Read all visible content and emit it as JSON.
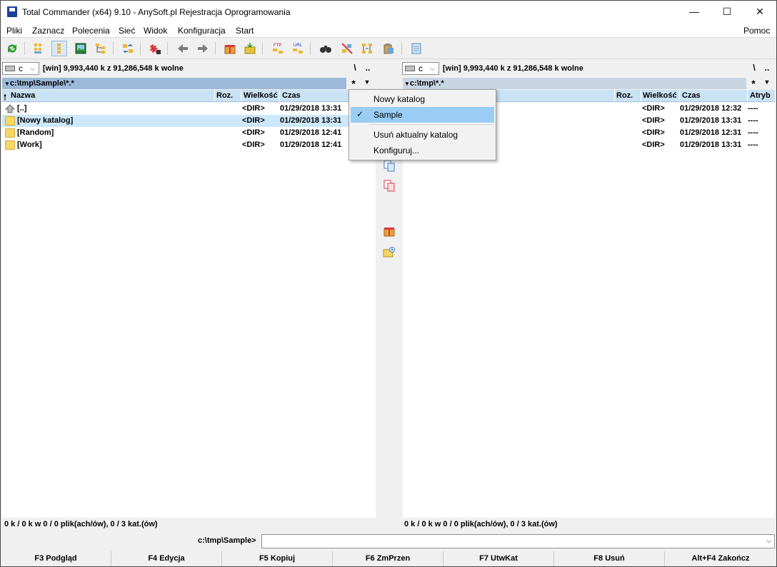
{
  "window": {
    "title": "Total Commander (x64) 9.10 - AnySoft.pl  Rejestracja Oprogramowania",
    "controls": [
      "—",
      "☐",
      "✕"
    ]
  },
  "menu": {
    "items": [
      "Pliki",
      "Zaznacz",
      "Polecenia",
      "Sieć",
      "Widok",
      "Konfiguracja",
      "Start"
    ],
    "help": "Pomoc"
  },
  "toolbar": {
    "icons": [
      "refresh-icon",
      "brief-view-icon",
      "full-view-icon",
      "thumbnails-view-icon",
      "tree-view-icon",
      "sync-dirs-icon",
      "invert-selection-icon",
      "back-icon",
      "forward-icon",
      "pack-icon",
      "unpack-icon",
      "ftp-icon",
      "url-icon",
      "search-icon",
      "multi-rename-icon",
      "compare-dirs-icon",
      "copy-names-icon",
      "notepad-icon"
    ]
  },
  "left_panel": {
    "drive_letter": "c",
    "drive_info": "[win]  9,993,440 k z 91,286,548 k wolne",
    "root_btn": "\\",
    "up_btn": "..",
    "hist_btn": "*",
    "path": "c:\\tmp\\Sample\\*.*",
    "columns": [
      "Nazwa",
      "Roz.",
      "Wielkość",
      "Czas"
    ],
    "rows": [
      {
        "name": "[..]",
        "size": "<DIR>",
        "date": "01/29/2018 13:31",
        "type": "up"
      },
      {
        "name": "[Nowy katalog]",
        "size": "<DIR>",
        "date": "01/29/2018 13:31",
        "type": "folder"
      },
      {
        "name": "[Random]",
        "size": "<DIR>",
        "date": "01/29/2018 12:41",
        "type": "folder"
      },
      {
        "name": "[Work]",
        "size": "<DIR>",
        "date": "01/29/2018 12:41",
        "type": "folder"
      }
    ],
    "status": "0 k / 0 k w 0 / 0 plik(ach/ów), 0 / 3 kat.(ów)"
  },
  "right_panel": {
    "drive_letter": "c",
    "drive_info": "[win]  9,993,440 k z 91,286,548 k wolne",
    "root_btn": "\\",
    "up_btn": "..",
    "hist_btn": "*",
    "path": "c:\\tmp\\*.*",
    "columns": [
      "Roz.",
      "Wielkość",
      "Czas",
      "Atryb"
    ],
    "rows": [
      {
        "size": "<DIR>",
        "date": "01/29/2018 12:32",
        "attr": "----"
      },
      {
        "size": "<DIR>",
        "date": "01/29/2018 13:31",
        "attr": "----"
      },
      {
        "size": "<DIR>",
        "date": "01/29/2018 12:31",
        "attr": "----"
      },
      {
        "size": "<DIR>",
        "date": "01/29/2018 13:31",
        "attr": "----"
      }
    ],
    "status": "0 k / 0 k w 0 / 0 plik(ach/ów), 0 / 3 kat.(ów)"
  },
  "dropdown": {
    "items": [
      "Nowy katalog",
      "Sample",
      "Usuń aktualny katalog",
      "Konfiguruj..."
    ],
    "selected": "Sample",
    "check": "✓"
  },
  "cmdline": {
    "label": "c:\\tmp\\Sample>",
    "value": ""
  },
  "fkeys": [
    "F3 Podgląd",
    "F4 Edycja",
    "F5 Kopiuj",
    "F6 ZmPrzen",
    "F7 UtwKat",
    "F8 Usuń",
    "Alt+F4 Zakończ"
  ],
  "colors": {
    "path_active": "#9cb9d9",
    "path_inactive": "#c8d6e4",
    "header": "#c9e2f4",
    "selected_row": "#cde8fa",
    "menu_highlight": "#99cdf5"
  }
}
